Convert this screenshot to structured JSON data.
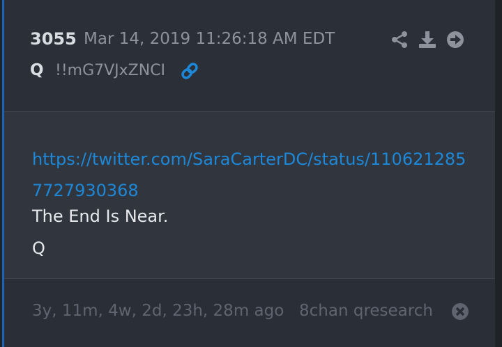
{
  "post": {
    "number": "3055",
    "date": "Mar 14, 2019 11:26:18 AM EDT",
    "author": "Q",
    "tripcode": "!!mG7VJxZNCI",
    "link": "https://twitter.com/SaraCarterDC/status/1106212857727930368",
    "lines": [
      "The End Is Near.",
      "Q"
    ]
  },
  "footer": {
    "age": "3y, 11m, 4w, 2d, 23h, 28m ago",
    "source": "8chan qresearch"
  },
  "colors": {
    "accent": "#1a63b8",
    "link": "#1e88d8",
    "text": "#e6e8eb",
    "muted": "#8d939c",
    "faint": "#5f6570"
  },
  "icons": [
    "share-icon",
    "download-icon",
    "arrow-right-circle-icon",
    "link-icon",
    "close-circle-icon"
  ]
}
